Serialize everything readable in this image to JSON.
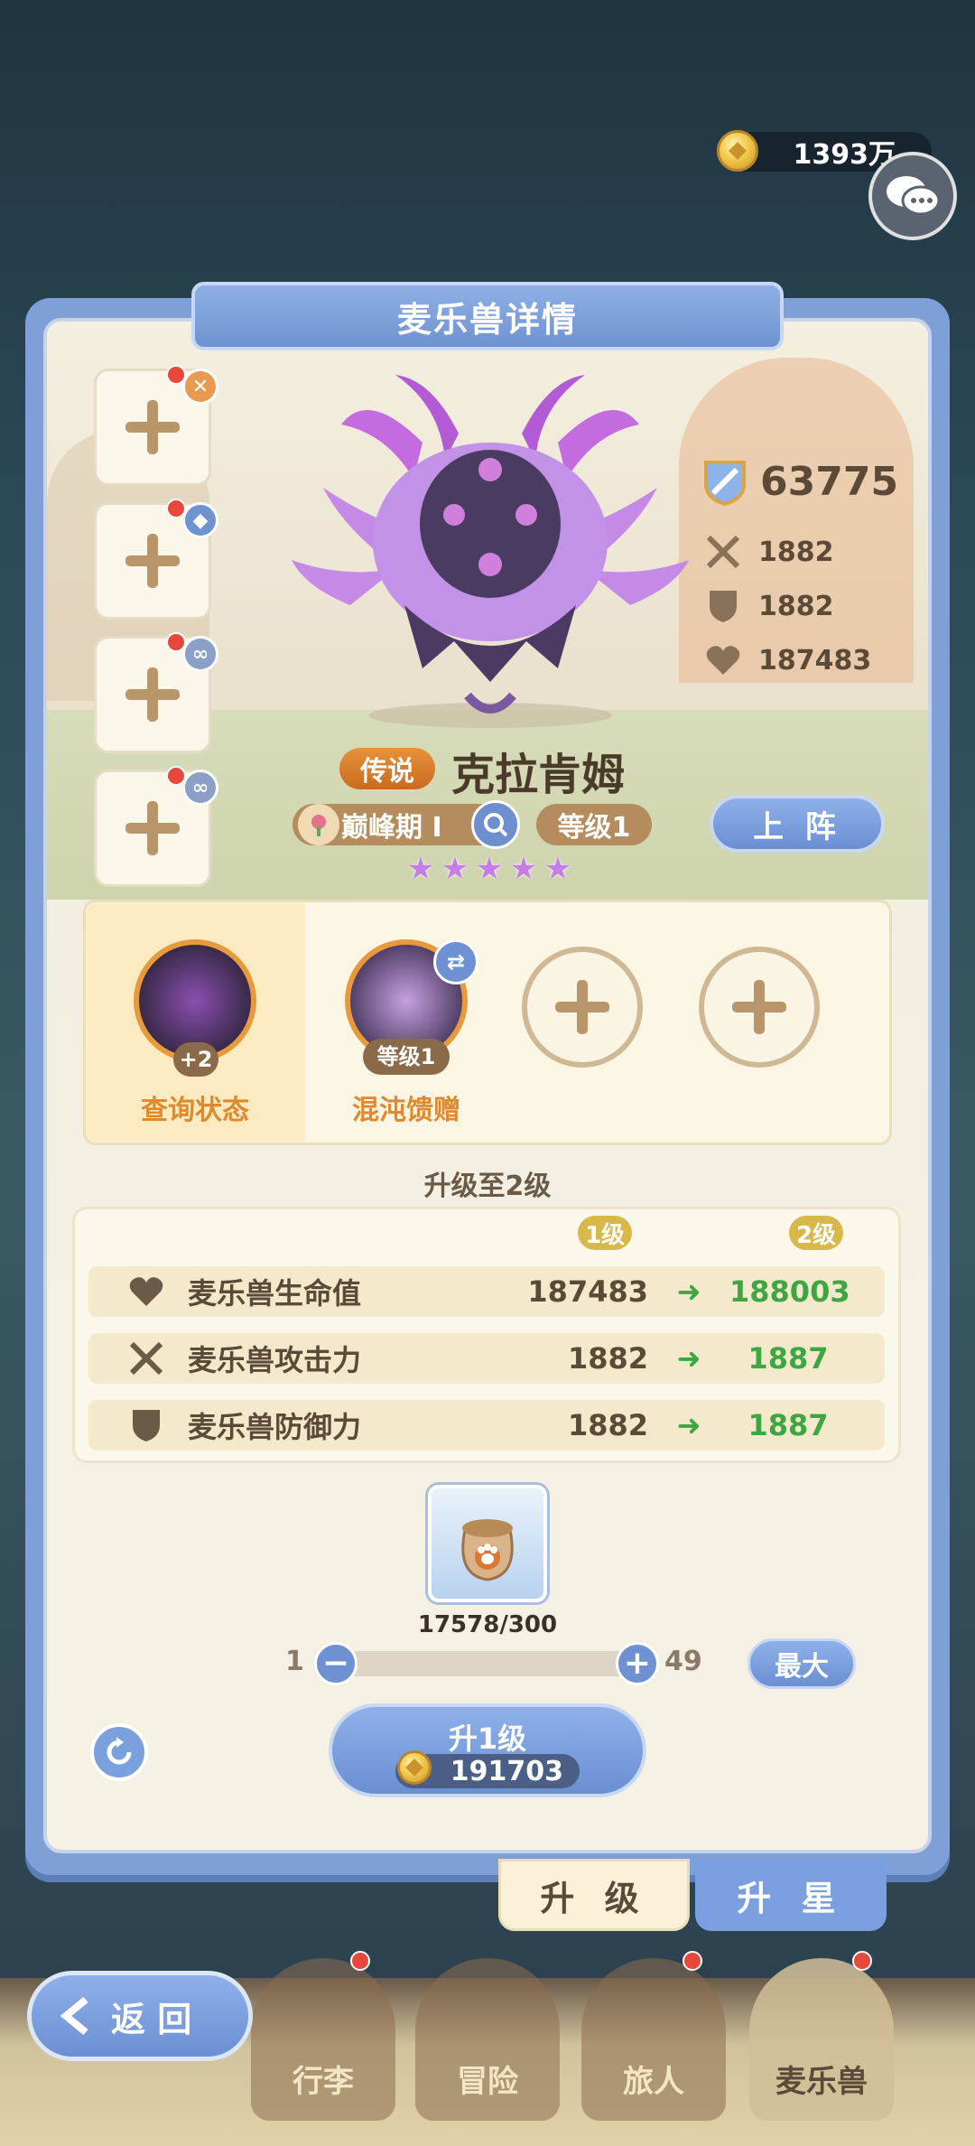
{
  "currency": {
    "gold": "1393万",
    "icon": "coin-icon"
  },
  "panel": {
    "title": "麦乐兽详情"
  },
  "stats": {
    "power": "63775",
    "attack": "1882",
    "defense": "1882",
    "hp": "187483"
  },
  "monster": {
    "rarity": "传说",
    "name": "克拉肯姆",
    "stage": "巅峰期 Ⅰ",
    "level": "等级1",
    "stars": 5,
    "deploy": "上 阵"
  },
  "skills": {
    "status_badge": "+2",
    "status_label": "查询状态",
    "skill_level": "等级1",
    "skill_label": "混沌馈赠"
  },
  "upgrade": {
    "title": "升级至2级",
    "from_level": "1级",
    "to_level": "2级",
    "rows": [
      {
        "name": "麦乐兽生命值",
        "old": "187483",
        "new": "188003",
        "icon": "heart-icon"
      },
      {
        "name": "麦乐兽攻击力",
        "old": "1882",
        "new": "1887",
        "icon": "swords-icon"
      },
      {
        "name": "麦乐兽防御力",
        "old": "1882",
        "new": "1887",
        "icon": "shield-icon"
      }
    ],
    "item_count": "17578/300",
    "slider_min": "1",
    "slider_max": "49",
    "max_label": "最大",
    "button_label": "升1级",
    "cost": "191703"
  },
  "tabs": {
    "upgrade": "升 级",
    "star": "升 星"
  },
  "nav": {
    "back": "返 回",
    "items": [
      "行李",
      "冒险",
      "旅人",
      "麦乐兽"
    ],
    "active": "麦乐兽"
  },
  "colors": {
    "accent": "#7b9ede",
    "gain": "#3fa644",
    "rarity": "#e08a30"
  }
}
